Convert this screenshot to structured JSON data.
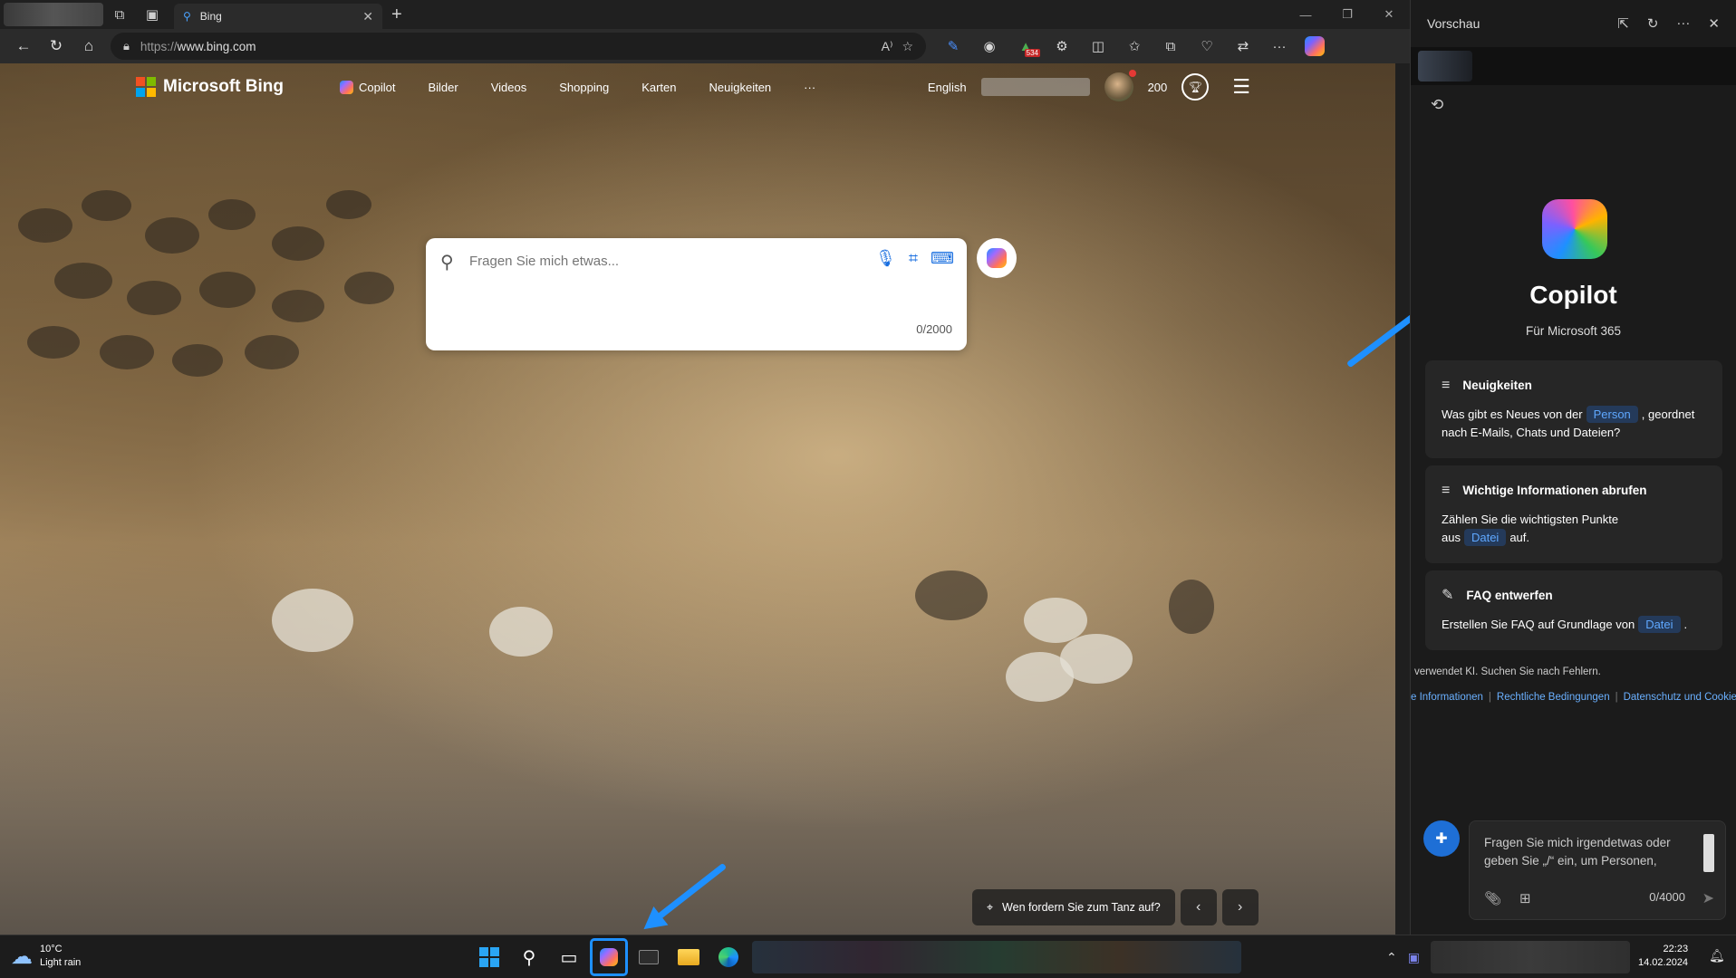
{
  "browser": {
    "tab_title": "Bing",
    "url_prefix": "https://",
    "url_host": "www.bing.com",
    "ext_badge": "534"
  },
  "bing": {
    "brand": "Microsoft Bing",
    "nav": [
      "Copilot",
      "Bilder",
      "Videos",
      "Shopping",
      "Karten",
      "Neuigkeiten",
      "···"
    ],
    "language": "English",
    "points": "200",
    "search_placeholder": "Fragen Sie mich etwas...",
    "search_counter": "0/2000",
    "tip_text": "Wen fordern Sie zum Tanz auf?"
  },
  "side_panel": {
    "title": "Vorschau",
    "app_name": "Copilot",
    "subtitle": "Für Microsoft 365",
    "cards": [
      {
        "title": "Neuigkeiten",
        "icon": "lines-icon",
        "before": "Was gibt es Neues von der",
        "chip": "Person",
        "after": ", geordnet nach E-Mails, Chats und Dateien?"
      },
      {
        "title": "Wichtige Informationen abrufen",
        "icon": "lines-icon",
        "before": "Zählen Sie die wichtigsten Punkte aus",
        "chip": "Datei",
        "after": "auf."
      },
      {
        "title": "FAQ entwerfen",
        "icon": "pencil-icon",
        "before": "Erstellen Sie FAQ auf Grundlage von",
        "chip": "Datei",
        "after": "."
      }
    ],
    "warning": "verwendet KI. Suchen Sie nach Fehlern.",
    "links": [
      "e Informationen",
      "Rechtliche Bedingungen",
      "Datenschutz und Cookie"
    ],
    "input_placeholder": "Fragen Sie mich irgendetwas oder geben Sie „/“ ein, um Personen,",
    "input_counter": "0/4000"
  },
  "taskbar": {
    "temperature": "10°C",
    "weather": "Light rain",
    "time": "22:23",
    "date": "14.02.2024"
  },
  "colors": {
    "accent": "#1e90ff",
    "chip_bg": "#243a5a",
    "chip_text": "#5fa8ff"
  }
}
